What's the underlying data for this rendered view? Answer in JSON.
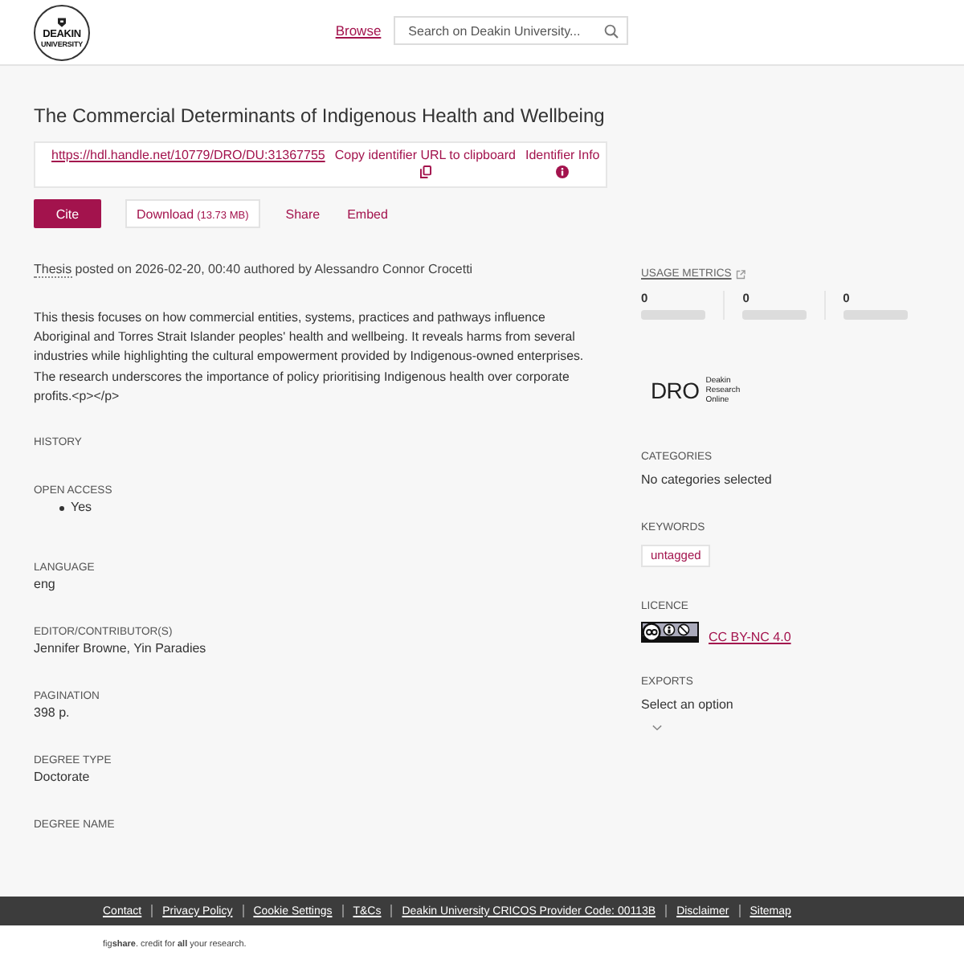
{
  "header": {
    "logo": {
      "wordmark": "DEAKIN",
      "subtitle": "UNIVERSITY"
    },
    "nav_link": "Browse",
    "search": {
      "placeholder": "Search on Deakin University..."
    }
  },
  "title": "The Commercial Determinants of Indigenous Health and Wellbeing",
  "identifier": {
    "url": "https://hdl.handle.net/10779/DRO/DU:31367755",
    "copy_label": "Copy identifier URL to clipboard",
    "info_label": "Identifier Info"
  },
  "actions": [
    {
      "kind": "primary",
      "label": "Cite"
    },
    {
      "kind": "outlined",
      "label": "Download",
      "size": "(13.73 MB)"
    },
    {
      "kind": "plain",
      "label": "Share"
    },
    {
      "kind": "plain",
      "label": "Embed"
    }
  ],
  "posted": {
    "type": "Thesis",
    "text": "posted on 2026-02-20, 00:40 authored by Alessandro Connor Crocetti"
  },
  "description": "This thesis focuses on how commercial entities, systems, practices and pathways influence Aboriginal and Torres Strait Islander peoples' health and wellbeing. It reveals harms from several industries while highlighting the cultural empowerment provided by Indigenous-owned enterprises. The research underscores the importance of policy prioritising Indigenous health over corporate profits.<p></p>",
  "details": [
    {
      "kind": "heading",
      "label": "HISTORY"
    },
    {
      "kind": "list",
      "label": "OPEN ACCESS",
      "items": [
        "Yes"
      ]
    },
    {
      "kind": "text",
      "label": "LANGUAGE",
      "value": "eng"
    },
    {
      "kind": "text",
      "label": "EDITOR/CONTRIBUTOR(S)",
      "value": "Jennifer Browne, Yin Paradies"
    },
    {
      "kind": "text",
      "label": "PAGINATION",
      "value": "398 p."
    },
    {
      "kind": "text",
      "label": "DEGREE TYPE",
      "value": "Doctorate"
    },
    {
      "kind": "heading",
      "label": "DEGREE NAME"
    }
  ],
  "sidebar": {
    "usage_metrics": {
      "title": "USAGE METRICS",
      "values": [
        "0",
        "0",
        "0"
      ]
    },
    "repository_logo": {
      "mark": "DRO",
      "lines": [
        "Deakin",
        "Research",
        "Online"
      ]
    },
    "categories": {
      "label": "CATEGORIES",
      "value": "No categories selected"
    },
    "keywords": {
      "label": "KEYWORDS",
      "tags": [
        "untagged"
      ]
    },
    "licence": {
      "label": "LICENCE",
      "link": "CC BY-NC 4.0"
    },
    "exports": {
      "label": "EXPORTS",
      "select": "Select an option"
    }
  },
  "footer": {
    "links": [
      "Contact",
      "Privacy Policy",
      "Cookie Settings",
      "T&Cs",
      "Deakin University CRICOS Provider Code: 00113B",
      "Disclaimer",
      "Sitemap"
    ],
    "credit": "fig**share**. credit for **all** your research."
  }
}
